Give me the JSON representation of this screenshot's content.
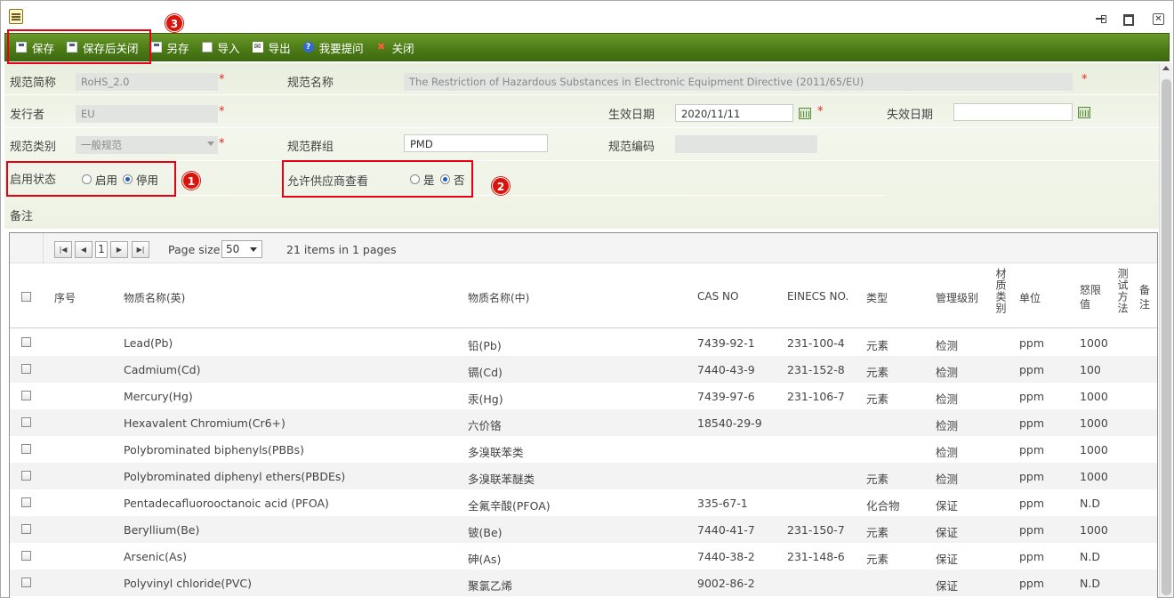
{
  "toolbar": {
    "save": "保存",
    "save_close": "保存后关闭",
    "save_as": "另存",
    "import": "导入",
    "export": "导出",
    "help": "我要提问",
    "close": "关闭"
  },
  "annotations": {
    "badge1": "1",
    "badge2": "2",
    "badge3": "3"
  },
  "form": {
    "spec_abbr_label": "规范简称",
    "spec_abbr_value": "RoHS_2.0",
    "spec_name_label": "规范名称",
    "spec_name_value": "The Restriction of Hazardous Substances in Electronic Equipment Directive (2011/65/EU)",
    "issuer_label": "发行者",
    "issuer_value": "EU",
    "effective_label": "生效日期",
    "effective_value": "2020/11/11",
    "expire_label": "失效日期",
    "expire_value": "",
    "category_label": "规范类别",
    "category_value": "一般规范",
    "group_label": "规范群组",
    "group_value": "PMD",
    "code_label": "规范编码",
    "code_value": "",
    "status_label": "启用状态",
    "status_enable": "启用",
    "status_disable": "停用",
    "status_selected": "停用",
    "supplier_label": "允许供应商查看",
    "supplier_yes": "是",
    "supplier_no": "否",
    "supplier_selected": "否",
    "remark_label": "备注",
    "required_mark": "*"
  },
  "pager": {
    "page": "1",
    "page_size_label": "Page size:",
    "page_size": "50",
    "summary": "21 items in 1 pages"
  },
  "grid": {
    "headers": {
      "seq": "序号",
      "name_en": "物质名称(英)",
      "name_cn": "物质名称(中)",
      "cas": "CAS NO",
      "einecs": "EINECS NO.",
      "type": "类型",
      "level": "管理级别",
      "material_category": "材质类别",
      "unit": "单位",
      "threshold": "怒限值",
      "test_method": "测试方法",
      "remark": "备注"
    },
    "rows": [
      {
        "name_en": "Lead(Pb)",
        "name_cn": "铅(Pb)",
        "cas": "7439-92-1",
        "einecs": "231-100-4",
        "type": "元素",
        "level": "检测",
        "unit": "ppm",
        "threshold": "1000"
      },
      {
        "name_en": "Cadmium(Cd)",
        "name_cn": "镉(Cd)",
        "cas": "7440-43-9",
        "einecs": "231-152-8",
        "type": "元素",
        "level": "检测",
        "unit": "ppm",
        "threshold": "100"
      },
      {
        "name_en": "Mercury(Hg)",
        "name_cn": "汞(Hg)",
        "cas": "7439-97-6",
        "einecs": "231-106-7",
        "type": "元素",
        "level": "检测",
        "unit": "ppm",
        "threshold": "1000"
      },
      {
        "name_en": "Hexavalent Chromium(Cr6+)",
        "name_cn": "六价铬",
        "cas": "18540-29-9",
        "einecs": "",
        "type": "",
        "level": "检测",
        "unit": "ppm",
        "threshold": "1000"
      },
      {
        "name_en": "Polybrominated biphenyls(PBBs)",
        "name_cn": "多溴联苯类",
        "cas": "",
        "einecs": "",
        "type": "",
        "level": "检测",
        "unit": "ppm",
        "threshold": "1000"
      },
      {
        "name_en": "Polybrominated diphenyl ethers(PBDEs)",
        "name_cn": "多溴联苯醚类",
        "cas": "",
        "einecs": "",
        "type": "元素",
        "level": "检测",
        "unit": "ppm",
        "threshold": "1000"
      },
      {
        "name_en": "Pentadecafluorooctanoic acid (PFOA)",
        "name_cn": "全氟辛酸(PFOA)",
        "cas": "335-67-1",
        "einecs": "",
        "type": "化合物",
        "level": "保证",
        "unit": "ppm",
        "threshold": "N.D"
      },
      {
        "name_en": "Beryllium(Be)",
        "name_cn": "铍(Be)",
        "cas": "7440-41-7",
        "einecs": "231-150-7",
        "type": "元素",
        "level": "保证",
        "unit": "ppm",
        "threshold": "1000"
      },
      {
        "name_en": "Arsenic(As)",
        "name_cn": "砷(As)",
        "cas": "7440-38-2",
        "einecs": "231-148-6",
        "type": "元素",
        "level": "保证",
        "unit": "ppm",
        "threshold": "N.D"
      },
      {
        "name_en": "Polyvinyl chloride(PVC)",
        "name_cn": "聚氯乙烯",
        "cas": "9002-86-2",
        "einecs": "",
        "type": "",
        "level": "保证",
        "unit": "ppm",
        "threshold": "N.D"
      }
    ]
  }
}
